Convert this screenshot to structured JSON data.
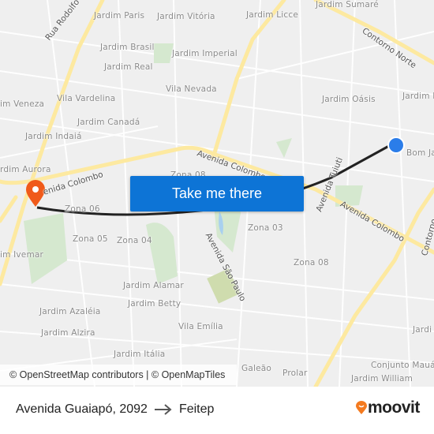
{
  "map": {
    "labels": [
      "Jardim Paris",
      "Jardim Vitória",
      "Jardim Licce",
      "Jardim Brasil",
      "Jardim Imperial",
      "Jardim Real",
      "Vila Nevada",
      "im Veneza",
      "Vila Vardelina",
      "Jardim Canadá",
      "Jardim Indaiá",
      "Jardim Oásis",
      "Jardim I",
      "Bom Ja",
      "rdim Aurora",
      "Zona 08",
      "Zona 06",
      "Zona 05",
      "Zona 04",
      "Zona 03",
      "Zona 08",
      "im Ivemar",
      "Jardim Alamar",
      "Jardim Betty",
      "Jardim Azaléia",
      "Jardim Alzira",
      "Vila Emília",
      "Jardim Itália",
      "Galeão",
      "Prolar",
      "Conjunto Mauá",
      "Jardim William",
      "Jardi",
      "Jardim Sumaré"
    ],
    "roads": [
      "Rua Rodolfo",
      "Contorno Norte",
      "Avenida Colombo",
      "enida Colombo",
      "Avenida Colombo",
      "Avenida Tuiuti",
      "Avenida São Paulo",
      "Contorno"
    ],
    "colors": {
      "road_major": "#fde9a0",
      "park": "#d5e8cf",
      "background": "#efefef",
      "route": "#222222",
      "origin": "#2b7de9",
      "destination": "#f05a1a"
    }
  },
  "cta": {
    "label": "Take me there"
  },
  "attribution": "© OpenStreetMap contributors | © OpenMapTiles",
  "footer": {
    "origin": "Avenida Guaiapó, 2092",
    "arrow_icon": "arrow-right-icon",
    "destination": "Feitep",
    "logo": "moovit"
  }
}
